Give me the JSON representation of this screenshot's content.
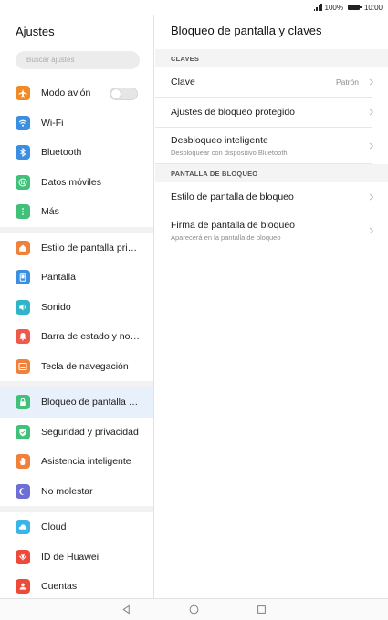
{
  "status": {
    "battery": "100%",
    "time": "10:00"
  },
  "left": {
    "title": "Ajustes",
    "search_placeholder": "Buscar ajustes",
    "groups": [
      [
        {
          "label": "Modo avión",
          "icon": "airplane-icon",
          "color": "#f08a24",
          "toggle": false
        },
        {
          "label": "Wi-Fi",
          "icon": "wifi-icon",
          "color": "#3b8fe2"
        },
        {
          "label": "Bluetooth",
          "icon": "bluetooth-icon",
          "color": "#3b8fe2"
        },
        {
          "label": "Datos móviles",
          "icon": "mobile-data-icon",
          "color": "#41c07a"
        },
        {
          "label": "Más",
          "icon": "more-icon",
          "color": "#41c07a"
        }
      ],
      [
        {
          "label": "Estilo de pantalla principal",
          "icon": "home-icon",
          "color": "#f0813a"
        },
        {
          "label": "Pantalla",
          "icon": "display-icon",
          "color": "#3b8fe2"
        },
        {
          "label": "Sonido",
          "icon": "sound-icon",
          "color": "#2fb4c8"
        },
        {
          "label": "Barra de estado y notificaciones",
          "icon": "notification-icon",
          "color": "#ee5a4a"
        },
        {
          "label": "Tecla de navegación",
          "icon": "navigation-key-icon",
          "color": "#f0813a"
        }
      ],
      [
        {
          "label": "Bloqueo de pantalla y claves",
          "icon": "lock-icon",
          "color": "#41c07a",
          "active": true
        },
        {
          "label": "Seguridad y privacidad",
          "icon": "shield-icon",
          "color": "#41c07a"
        },
        {
          "label": "Asistencia inteligente",
          "icon": "hand-icon",
          "color": "#f0813a"
        },
        {
          "label": "No molestar",
          "icon": "moon-icon",
          "color": "#6b6fd6"
        }
      ],
      [
        {
          "label": "Cloud",
          "icon": "cloud-icon",
          "color": "#3bb4e8"
        },
        {
          "label": "ID de Huawei",
          "icon": "huawei-icon",
          "color": "#ee4a3a"
        },
        {
          "label": "Cuentas",
          "icon": "account-icon",
          "color": "#ee4a3a"
        }
      ]
    ]
  },
  "right": {
    "title": "Bloqueo de pantalla y claves",
    "section1": "CLAVES",
    "rows1": [
      {
        "title": "Clave",
        "value": "Patrón"
      },
      {
        "title": "Ajustes de bloqueo protegido"
      },
      {
        "title": "Desbloqueo inteligente",
        "subtitle": "Desbloquear con dispositivo Bluetooth"
      }
    ],
    "section2": "PANTALLA DE BLOQUEO",
    "rows2": [
      {
        "title": "Estilo de pantalla de bloqueo"
      },
      {
        "title": "Firma de pantalla de bloqueo",
        "subtitle": "Aparecerá en la pantalla de bloqueo"
      }
    ]
  },
  "nav": {
    "back": "back-icon",
    "home": "home-circle-icon",
    "recents": "recents-icon"
  }
}
